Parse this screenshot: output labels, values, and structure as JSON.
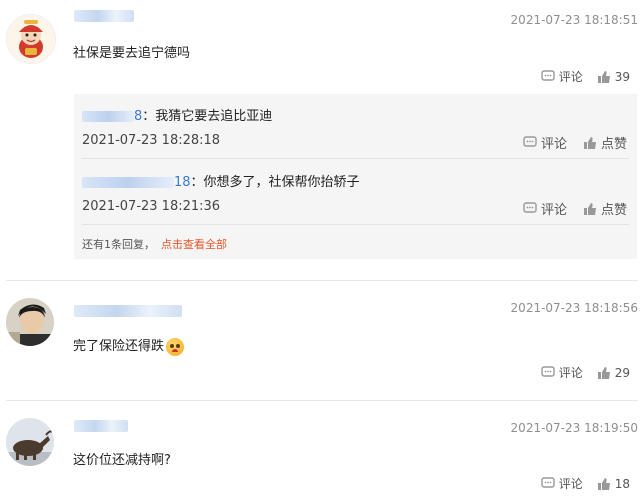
{
  "comments": [
    {
      "time": "2021-07-23 18:18:51",
      "text": "社保是要去追宁德吗",
      "reply_label": "评论",
      "likes": "39"
    },
    {
      "time": "2021-07-23 18:18:56",
      "text": "完了保险还得跌",
      "reply_label": "评论",
      "likes": "29"
    },
    {
      "time": "2021-07-23 18:19:50",
      "text": "这价位还减持啊?",
      "reply_label": "评论",
      "likes": "18"
    }
  ],
  "replies": [
    {
      "name_suffix": "8",
      "text": "：我猜它要去追比亚迪",
      "time": "2021-07-23 18:28:18",
      "reply_label": "评论",
      "like_label": "点赞"
    },
    {
      "name_suffix": "18",
      "text": "：你想多了，社保帮你抬轿子",
      "time": "2021-07-23 18:21:36",
      "reply_label": "评论",
      "like_label": "点赞"
    }
  ],
  "more": {
    "count_text": "还有1条回复，",
    "link_text": "点击查看全部"
  },
  "icons": {
    "comment": "comment-icon",
    "like": "thumbs-up-icon"
  }
}
